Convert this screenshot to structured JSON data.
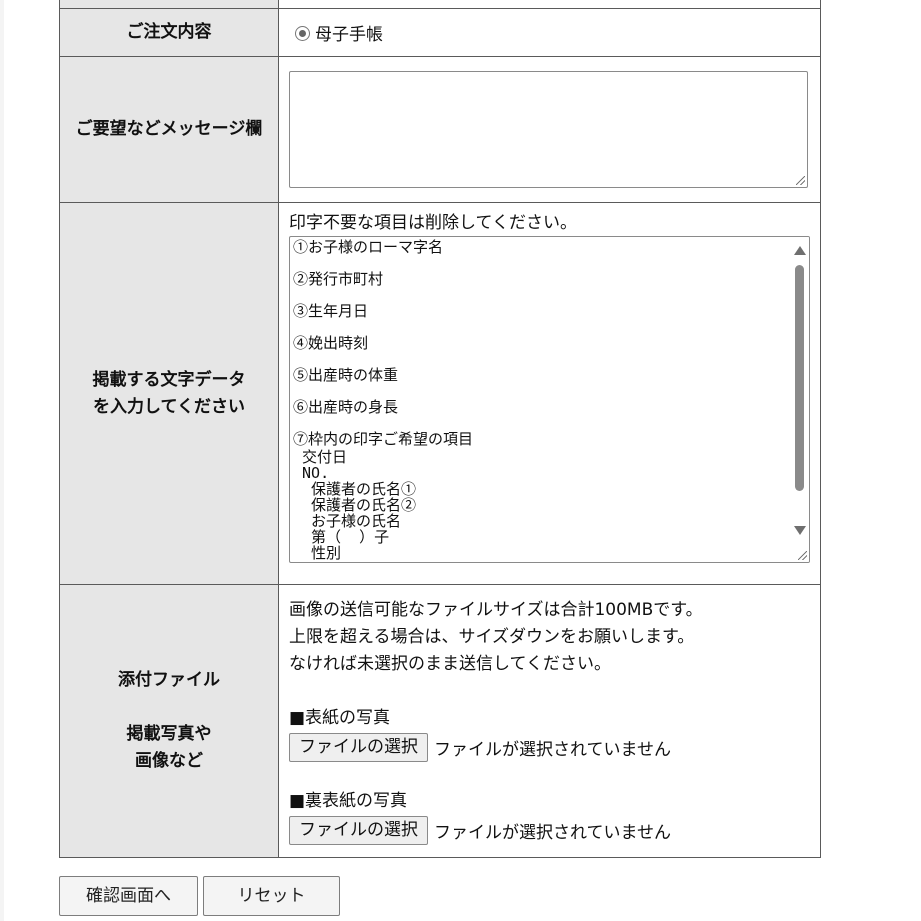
{
  "order": {
    "label": "ご注文内容",
    "option": "母子手帳"
  },
  "message": {
    "label": "ご要望などメッセージ欄",
    "value": ""
  },
  "text_data": {
    "label_line1": "掲載する文字データ",
    "label_line2": "を入力してください",
    "note": "印字不要な項目は削除してください。",
    "lines": [
      "①お子様のローマ字名",
      "②発行市町村",
      "③生年月日",
      "④娩出時刻",
      "⑤出産時の体重",
      "⑥出産時の身長",
      "⑦枠内の印字ご希望の項目"
    ],
    "sublines": [
      " 交付日",
      " NO.",
      "  保護者の氏名①",
      "  保護者の氏名②",
      "  お子様の氏名",
      "  第（  ）子",
      "  性別"
    ]
  },
  "attachments": {
    "label_line1": "添付ファイル",
    "label_line2": "掲載写真や",
    "label_line3": "画像など",
    "info": [
      "画像の送信可能なファイルサイズは合計100MBです。",
      "上限を超える場合は、サイズダウンをお願いします。",
      "なければ未選択のまま送信してください。"
    ],
    "front_label": "■表紙の写真",
    "back_label": "■裏表紙の写真",
    "choose_button": "ファイルの選択",
    "no_file": "ファイルが選択されていません"
  },
  "buttons": {
    "confirm": "確認画面へ",
    "reset": "リセット"
  },
  "colors": {
    "header_bg": "#e6e6e6",
    "border": "#5a5a5a"
  }
}
